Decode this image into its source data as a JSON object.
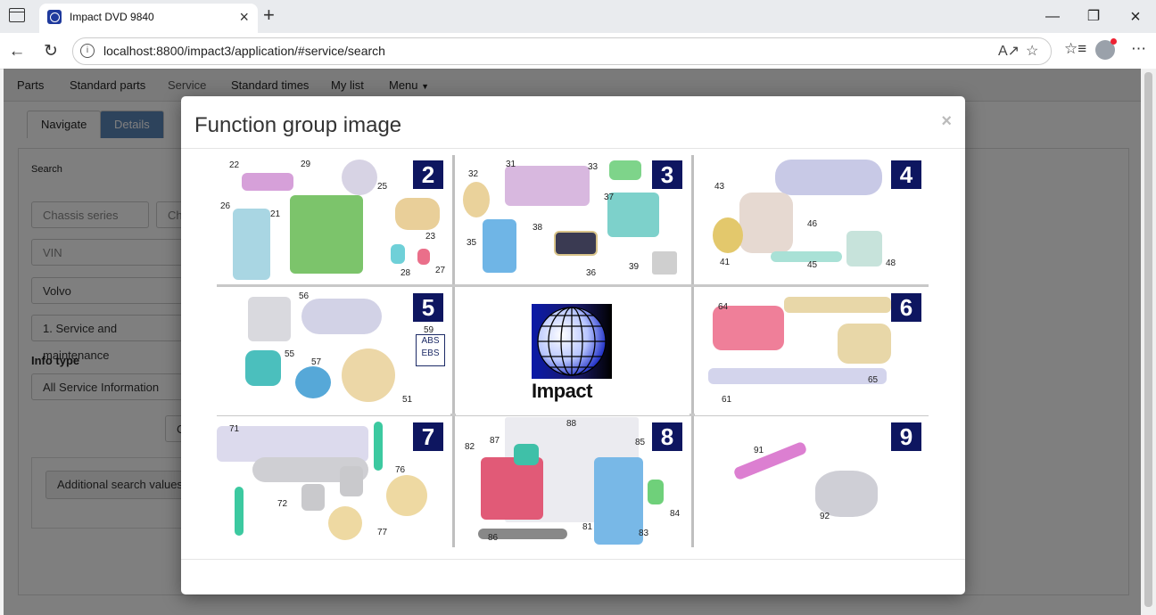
{
  "browser": {
    "tab_title": "Impact DVD 9840",
    "url": "localhost:8800/impact3/application/#service/search"
  },
  "navbar": {
    "items": [
      "Parts",
      "Standard parts",
      "Service",
      "Standard times",
      "My list",
      "Menu"
    ]
  },
  "subtabs": [
    "Navigate",
    "Details"
  ],
  "search": {
    "heading": "Search",
    "chassis_placeholder": "Chassis series",
    "ch_partial": "Ch",
    "vin_placeholder": "VIN",
    "make_value": "Volvo",
    "function_value": "1. Service and maintenance",
    "info_type_label": "Info type",
    "info_type_value": "All Service Information",
    "additional_button": "Additional search values",
    "small_button": "C"
  },
  "modal": {
    "title": "Function group image",
    "close": "×"
  },
  "function_groups": [
    {
      "number": "2",
      "callouts": [
        "22",
        "29",
        "25",
        "26",
        "21",
        "23",
        "28",
        "27"
      ]
    },
    {
      "number": "3",
      "callouts": [
        "32",
        "31",
        "33",
        "37",
        "35",
        "38",
        "36",
        "39"
      ]
    },
    {
      "number": "4",
      "callouts": [
        "43",
        "46",
        "41",
        "45",
        "48"
      ]
    },
    {
      "number": "5",
      "callouts": [
        "56",
        "59",
        "55",
        "57",
        "51"
      ],
      "abs": "ABS",
      "ebs": "EBS"
    },
    {
      "logo": "Impact"
    },
    {
      "number": "6",
      "callouts": [
        "64",
        "65",
        "61"
      ]
    },
    {
      "number": "7",
      "callouts": [
        "71",
        "76",
        "72",
        "77"
      ]
    },
    {
      "number": "8",
      "callouts": [
        "88",
        "82",
        "87",
        "85",
        "84",
        "86",
        "81",
        "83"
      ]
    },
    {
      "number": "9",
      "callouts": [
        "91",
        "92"
      ]
    }
  ]
}
